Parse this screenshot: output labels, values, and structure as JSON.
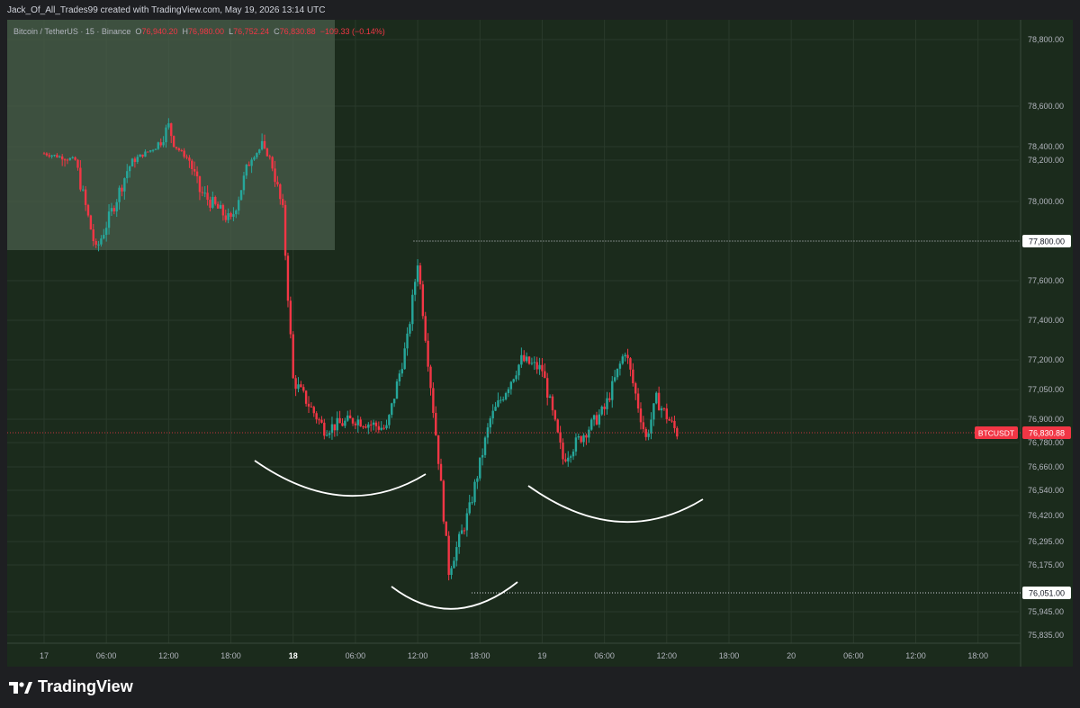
{
  "header": {
    "caption": "Jack_Of_All_Trades99 created with TradingView.com, May 19, 2026 13:14 UTC"
  },
  "legend": {
    "symbol": "Bitcoin / TetherUS · 15 · Binance",
    "o_label": "O",
    "o_value": "76,940.20",
    "h_label": "H",
    "h_value": "76,980.00",
    "l_label": "L",
    "l_value": "76,752.24",
    "c_label": "C",
    "c_value": "76,830.88",
    "change": "−109.33 (−0.14%)"
  },
  "colors": {
    "background": "#1b2b1c",
    "up": "#26a69a",
    "down": "#f23645",
    "highlight_box": "#4a5d4b",
    "price_tag": "#f23645"
  },
  "footer": {
    "brand": "TradingView"
  },
  "chart_data": {
    "type": "candlestick",
    "title": "Bitcoin / TetherUS · 15 · Binance",
    "x_ticks": [
      "17",
      "06:00",
      "12:00",
      "18:00",
      "18",
      "06:00",
      "12:00",
      "18:00",
      "19",
      "06:00",
      "12:00",
      "18:00",
      "20",
      "06:00",
      "12:00",
      "18:00"
    ],
    "y_ticks": [
      "78,800.00",
      "78,600.00",
      "78,400.00",
      "78,200.00",
      "78,000.00",
      "77,600.00",
      "77,400.00",
      "77,200.00",
      "77,050.00",
      "76,900.00",
      "76,780.00",
      "76,660.00",
      "76,540.00",
      "76,420.00",
      "76,295.00",
      "76,175.00",
      "75,945.00",
      "75,835.00"
    ],
    "ylim": [
      75800,
      78900
    ],
    "close_path_approx": [
      {
        "t": "17 00:00",
        "p": 78300
      },
      {
        "t": "17 03:00",
        "p": 78200
      },
      {
        "t": "17 05:00",
        "p": 77750
      },
      {
        "t": "17 08:00",
        "p": 78150
      },
      {
        "t": "17 12:00",
        "p": 78500
      },
      {
        "t": "17 15:00",
        "p": 78050
      },
      {
        "t": "17 18:00",
        "p": 77900
      },
      {
        "t": "17 21:00",
        "p": 78400
      },
      {
        "t": "17 23:00",
        "p": 77950
      },
      {
        "t": "18 00:00",
        "p": 77100
      },
      {
        "t": "18 03:00",
        "p": 76850
      },
      {
        "t": "18 06:00",
        "p": 76900
      },
      {
        "t": "18 09:00",
        "p": 76850
      },
      {
        "t": "18 11:00",
        "p": 77300
      },
      {
        "t": "18 12:00",
        "p": 77700
      },
      {
        "t": "18 14:00",
        "p": 76700
      },
      {
        "t": "18 15:00",
        "p": 76150
      },
      {
        "t": "18 17:00",
        "p": 76450
      },
      {
        "t": "18 19:00",
        "p": 76900
      },
      {
        "t": "18 22:00",
        "p": 77200
      },
      {
        "t": "19 00:00",
        "p": 77150
      },
      {
        "t": "19 02:00",
        "p": 76700
      },
      {
        "t": "19 06:00",
        "p": 76950
      },
      {
        "t": "19 08:00",
        "p": 77250
      },
      {
        "t": "19 10:00",
        "p": 76800
      },
      {
        "t": "19 11:00",
        "p": 77000
      },
      {
        "t": "19 13:00",
        "p": 76830
      }
    ],
    "last_price": "76,830.88",
    "last_price_label": "BTCUSDT",
    "levels": [
      {
        "label": "77,800.00",
        "value": 77800
      },
      {
        "label": "76,051.00",
        "value": 76051
      }
    ],
    "annotations": [
      {
        "type": "arc",
        "name": "left-shoulder"
      },
      {
        "type": "arc",
        "name": "head"
      },
      {
        "type": "arc",
        "name": "right-shoulder"
      }
    ],
    "grid": true
  }
}
